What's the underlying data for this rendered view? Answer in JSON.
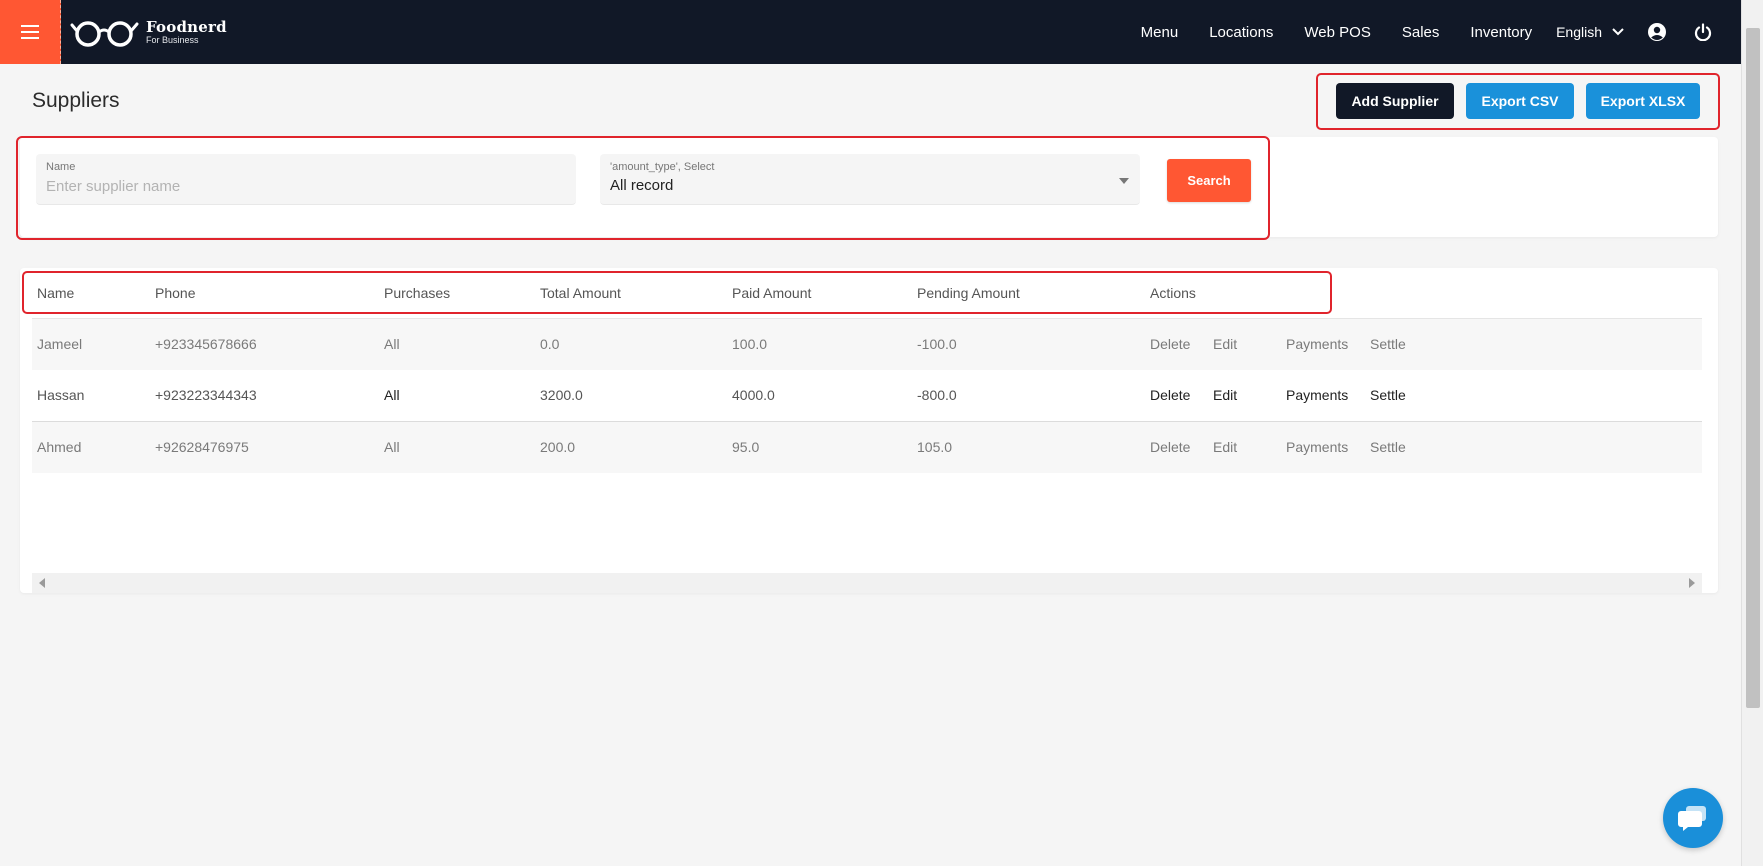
{
  "navbar": {
    "logo": {
      "name": "Foodnerd",
      "tagline": "For Business"
    },
    "links": [
      "Menu",
      "Locations",
      "Web POS",
      "Sales",
      "Inventory"
    ],
    "language": "English",
    "icons": {
      "menu": "hamburger-icon",
      "account": "account-circle-icon",
      "power": "power-icon"
    }
  },
  "page": {
    "title": "Suppliers",
    "actions": {
      "add": "Add Supplier",
      "csv": "Export CSV",
      "xlsx": "Export XLSX"
    }
  },
  "filters": {
    "name_label": "Name",
    "name_placeholder": "Enter supplier name",
    "name_value": "",
    "type_label": "'amount_type', Select",
    "type_value": "All record",
    "search_label": "Search"
  },
  "table": {
    "columns": [
      "Name",
      "Phone",
      "Purchases",
      "Total Amount",
      "Paid Amount",
      "Pending Amount",
      "Actions"
    ],
    "rows": [
      {
        "name": "Jameel",
        "phone": "+923345678666",
        "purchases": "All",
        "total": "0.0",
        "paid": "100.0",
        "pending": "-100.0"
      },
      {
        "name": "Hassan",
        "phone": "+923223344343",
        "purchases": "All",
        "total": "3200.0",
        "paid": "4000.0",
        "pending": "-800.0"
      },
      {
        "name": "Ahmed",
        "phone": "+92628476975",
        "purchases": "All",
        "total": "200.0",
        "paid": "95.0",
        "pending": "105.0"
      }
    ],
    "actions": [
      "Delete",
      "Edit",
      "Payments",
      "Settle"
    ]
  },
  "colors": {
    "navbar": "#111827",
    "accent": "#ff5733",
    "primary_blue": "#1a91da",
    "highlight_red": "#e0242c"
  }
}
